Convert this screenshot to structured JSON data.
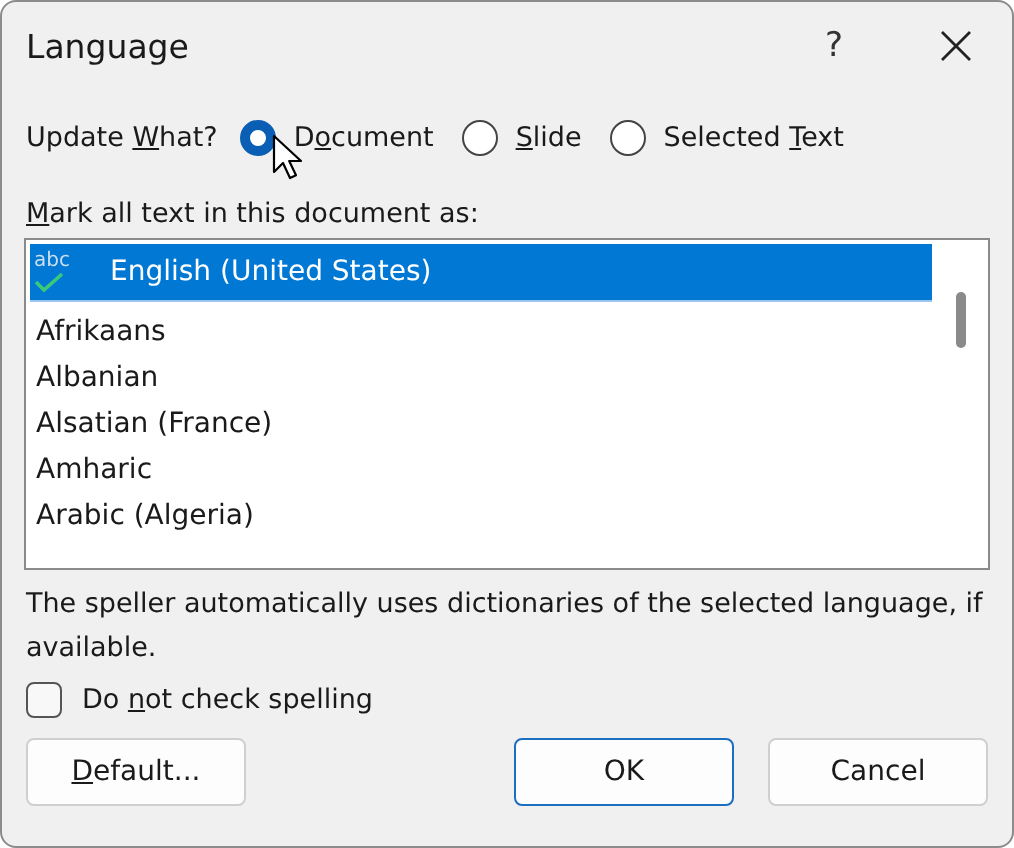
{
  "window": {
    "title": "Language",
    "help": "?"
  },
  "update_what": {
    "label": {
      "before": "Update ",
      "accel": "W",
      "after": "hat?"
    },
    "options": [
      {
        "label": {
          "before": "D",
          "accel": "o",
          "after": "cument"
        },
        "selected": true
      },
      {
        "label": {
          "accel": "S",
          "after": "lide"
        },
        "selected": false
      },
      {
        "label": {
          "before": "Selected ",
          "accel": "T",
          "after": "ext"
        },
        "selected": false
      }
    ]
  },
  "list_label": {
    "accel": "M",
    "after": "ark all text in this document as:"
  },
  "languages": [
    {
      "name": "English (United States)",
      "selected": true,
      "kind": "spellcheck",
      "badge": "abc"
    },
    {
      "name": "Afrikaans",
      "selected": false
    },
    {
      "name": "Albanian",
      "selected": false
    },
    {
      "name": "Alsatian (France)",
      "selected": false
    },
    {
      "name": "Amharic",
      "selected": false
    },
    {
      "name": "Arabic (Algeria)",
      "selected": false
    }
  ],
  "note": "The speller automatically uses dictionaries of the selected language, if available.",
  "no_spell_check": {
    "label": {
      "before": "Do ",
      "accel": "n",
      "after": "ot check spelling"
    },
    "checked": false
  },
  "buttons": [
    {
      "label": {
        "accel": "D",
        "after": "efault..."
      },
      "default": false
    },
    {
      "label": {
        "before": "OK"
      },
      "default": true
    },
    {
      "label": {
        "before": "Cancel"
      },
      "default": false
    }
  ]
}
